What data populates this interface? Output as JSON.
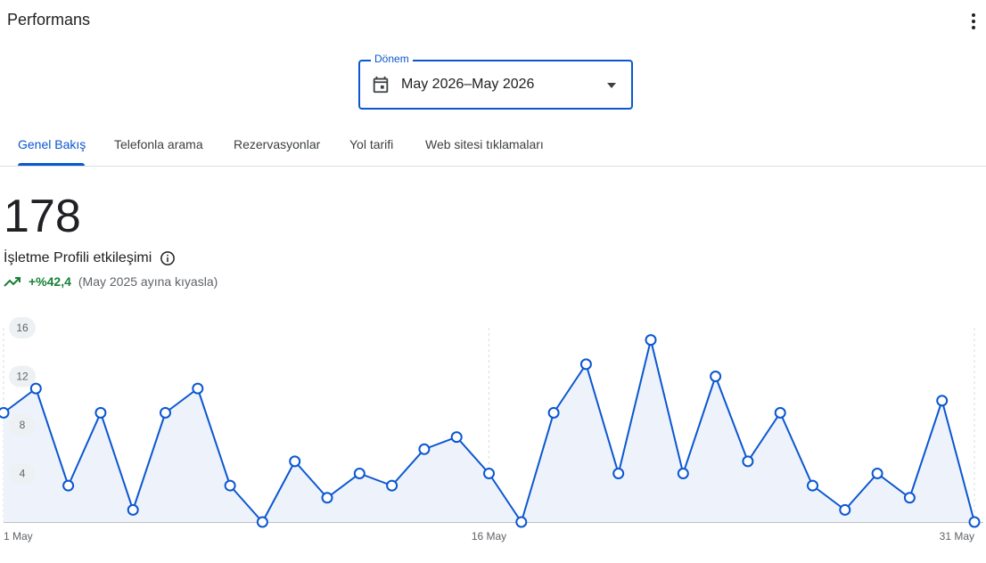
{
  "header": {
    "title": "Performans"
  },
  "period": {
    "label": "Dönem",
    "value": "May 2026–May 2026"
  },
  "tabs": [
    {
      "label": "Genel Bakış",
      "active": true
    },
    {
      "label": "Telefonla arama",
      "active": false
    },
    {
      "label": "Rezervasyonlar",
      "active": false
    },
    {
      "label": "Yol tarifi",
      "active": false
    },
    {
      "label": "Web sitesi tıklamaları",
      "active": false
    }
  ],
  "metric": {
    "total": "178",
    "label": "İşletme Profili etkileşimi",
    "trend": "+%42,4",
    "comparison": "(May 2025 ayına kıyasla)"
  },
  "colors": {
    "accent": "#0b57d0",
    "trend_up": "#188038",
    "area_fill": "#eef3fb"
  },
  "icons": {
    "menu": "more-vert-icon",
    "calendar": "calendar-icon",
    "dropdown": "arrow-drop-down-icon",
    "info": "info-icon",
    "trend": "trending-up-icon"
  },
  "chart_data": {
    "type": "line",
    "x": [
      "1 May",
      "2 May",
      "3 May",
      "4 May",
      "5 May",
      "6 May",
      "7 May",
      "8 May",
      "9 May",
      "10 May",
      "11 May",
      "12 May",
      "13 May",
      "14 May",
      "15 May",
      "16 May",
      "17 May",
      "18 May",
      "19 May",
      "20 May",
      "21 May",
      "22 May",
      "23 May",
      "24 May",
      "25 May",
      "26 May",
      "27 May",
      "28 May",
      "29 May",
      "30 May",
      "31 May"
    ],
    "values": [
      9,
      11,
      3,
      9,
      1,
      9,
      11,
      3,
      0,
      5,
      2,
      4,
      3,
      6,
      7,
      4,
      0,
      9,
      13,
      4,
      15,
      4,
      12,
      5,
      9,
      3,
      1,
      4,
      2,
      10,
      0
    ],
    "xtick_labels": [
      "1 May",
      "16 May",
      "31 May"
    ],
    "yticks": [
      4,
      8,
      12,
      16
    ],
    "ylim": [
      0,
      16
    ],
    "grid": "vertical-dashed"
  }
}
